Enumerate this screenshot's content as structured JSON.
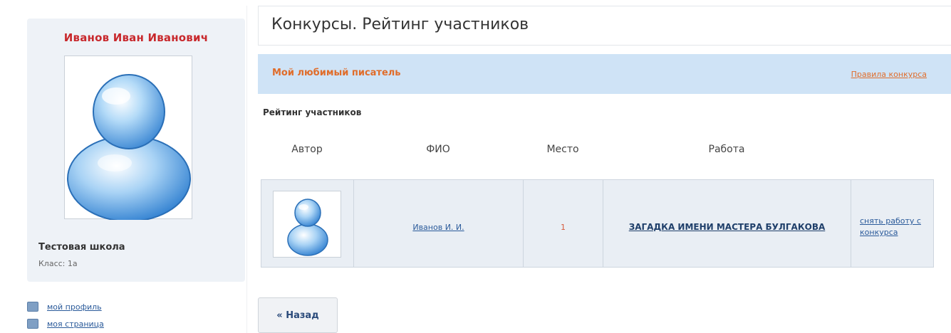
{
  "sidebar": {
    "profile_name": "Иванов Иван Иванович",
    "school": "Тестовая школа",
    "class_label": "Класс: 1а",
    "links": [
      {
        "label": "мой профиль",
        "icon": "profile-icon"
      },
      {
        "label": "моя страница",
        "icon": "page-icon"
      }
    ]
  },
  "main": {
    "title": "Конкурсы. Рейтинг участников",
    "contest": {
      "name": "Мой любимый писатель",
      "rules_link": "Правила конкурса"
    },
    "rating_heading": "Рейтинг участников",
    "table": {
      "headers": [
        "Автор",
        "ФИО",
        "Место",
        "Работа"
      ],
      "rows": [
        {
          "fio": "Иванов И. И.",
          "place": "1",
          "work": "ЗАГАДКА ИМЕНИ МАСТЕРА БУЛГАКОВА",
          "action": "снять работу с конкурса"
        }
      ]
    },
    "back_button": "« Назад"
  },
  "colors": {
    "profile_name": "#c8282c",
    "contest_bar": "#cfe3f6",
    "contest_text": "#e06d2b",
    "link": "#2a5a9a"
  }
}
